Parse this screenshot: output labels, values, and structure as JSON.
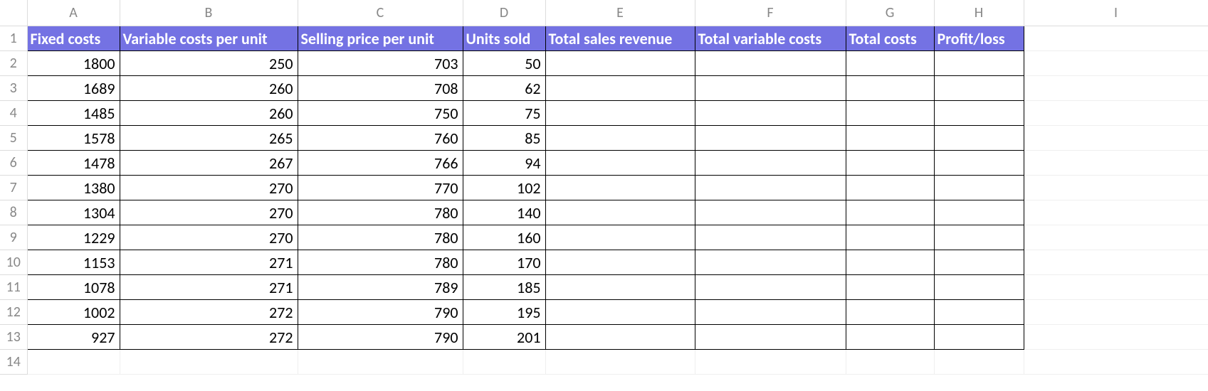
{
  "columns": [
    "A",
    "B",
    "C",
    "D",
    "E",
    "F",
    "G",
    "H",
    "I"
  ],
  "row_numbers": [
    1,
    2,
    3,
    4,
    5,
    6,
    7,
    8,
    9,
    10,
    11,
    12,
    13,
    14
  ],
  "headers": {
    "A": "Fixed costs",
    "B": "Variable costs per unit",
    "C": "Selling price per unit",
    "D": "Units sold",
    "E": "Total sales revenue",
    "F": "Total variable costs",
    "G": "Total costs",
    "H": "Profit/loss"
  },
  "rows": [
    {
      "A": "1800",
      "B": "250",
      "C": "703",
      "D": "50",
      "E": "",
      "F": "",
      "G": "",
      "H": ""
    },
    {
      "A": "1689",
      "B": "260",
      "C": "708",
      "D": "62",
      "E": "",
      "F": "",
      "G": "",
      "H": ""
    },
    {
      "A": "1485",
      "B": "260",
      "C": "750",
      "D": "75",
      "E": "",
      "F": "",
      "G": "",
      "H": ""
    },
    {
      "A": "1578",
      "B": "265",
      "C": "760",
      "D": "85",
      "E": "",
      "F": "",
      "G": "",
      "H": ""
    },
    {
      "A": "1478",
      "B": "267",
      "C": "766",
      "D": "94",
      "E": "",
      "F": "",
      "G": "",
      "H": ""
    },
    {
      "A": "1380",
      "B": "270",
      "C": "770",
      "D": "102",
      "E": "",
      "F": "",
      "G": "",
      "H": ""
    },
    {
      "A": "1304",
      "B": "270",
      "C": "780",
      "D": "140",
      "E": "",
      "F": "",
      "G": "",
      "H": ""
    },
    {
      "A": "1229",
      "B": "270",
      "C": "780",
      "D": "160",
      "E": "",
      "F": "",
      "G": "",
      "H": ""
    },
    {
      "A": "1153",
      "B": "271",
      "C": "780",
      "D": "170",
      "E": "",
      "F": "",
      "G": "",
      "H": ""
    },
    {
      "A": "1078",
      "B": "271",
      "C": "789",
      "D": "185",
      "E": "",
      "F": "",
      "G": "",
      "H": ""
    },
    {
      "A": "1002",
      "B": "272",
      "C": "790",
      "D": "195",
      "E": "",
      "F": "",
      "G": "",
      "H": ""
    },
    {
      "A": "927",
      "B": "272",
      "C": "790",
      "D": "201",
      "E": "",
      "F": "",
      "G": "",
      "H": ""
    }
  ],
  "chart_data": {
    "type": "table",
    "columns": [
      "Fixed costs",
      "Variable costs per unit",
      "Selling price per unit",
      "Units sold",
      "Total sales revenue",
      "Total variable costs",
      "Total costs",
      "Profit/loss"
    ],
    "rows": [
      [
        1800,
        250,
        703,
        50,
        null,
        null,
        null,
        null
      ],
      [
        1689,
        260,
        708,
        62,
        null,
        null,
        null,
        null
      ],
      [
        1485,
        260,
        750,
        75,
        null,
        null,
        null,
        null
      ],
      [
        1578,
        265,
        760,
        85,
        null,
        null,
        null,
        null
      ],
      [
        1478,
        267,
        766,
        94,
        null,
        null,
        null,
        null
      ],
      [
        1380,
        270,
        770,
        102,
        null,
        null,
        null,
        null
      ],
      [
        1304,
        270,
        780,
        140,
        null,
        null,
        null,
        null
      ],
      [
        1229,
        270,
        780,
        160,
        null,
        null,
        null,
        null
      ],
      [
        1153,
        271,
        780,
        170,
        null,
        null,
        null,
        null
      ],
      [
        1078,
        271,
        789,
        185,
        null,
        null,
        null,
        null
      ],
      [
        1002,
        272,
        790,
        195,
        null,
        null,
        null,
        null
      ],
      [
        927,
        272,
        790,
        201,
        null,
        null,
        null,
        null
      ]
    ]
  }
}
